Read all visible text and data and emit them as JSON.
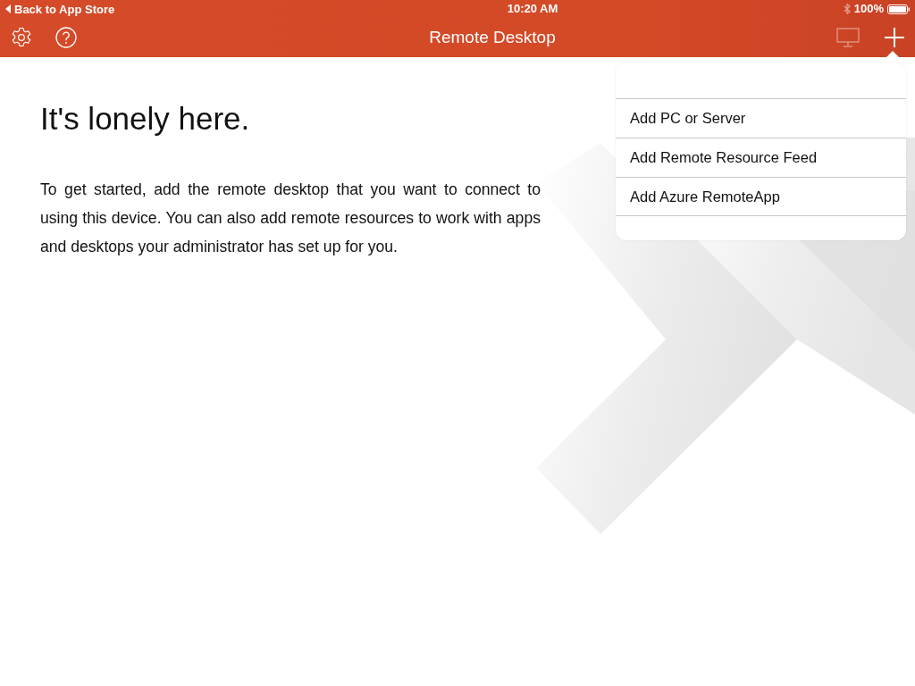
{
  "status_bar": {
    "back_label": "Back to App Store",
    "time": "10:20 AM",
    "battery": "100%"
  },
  "nav_bar": {
    "title": "Remote Desktop",
    "desktop_button": {
      "disabled": true
    }
  },
  "empty_state": {
    "heading": "It's lonely here.",
    "body": "To get started, add the remote desktop that you want to connect to using this device. You can also add remote resources to work with apps and desktops your administrator has set up for you."
  },
  "add_menu": {
    "items": [
      {
        "label": "Add PC or Server"
      },
      {
        "label": "Add Remote Resource Feed"
      },
      {
        "label": "Add Azure RemoteApp"
      }
    ]
  }
}
